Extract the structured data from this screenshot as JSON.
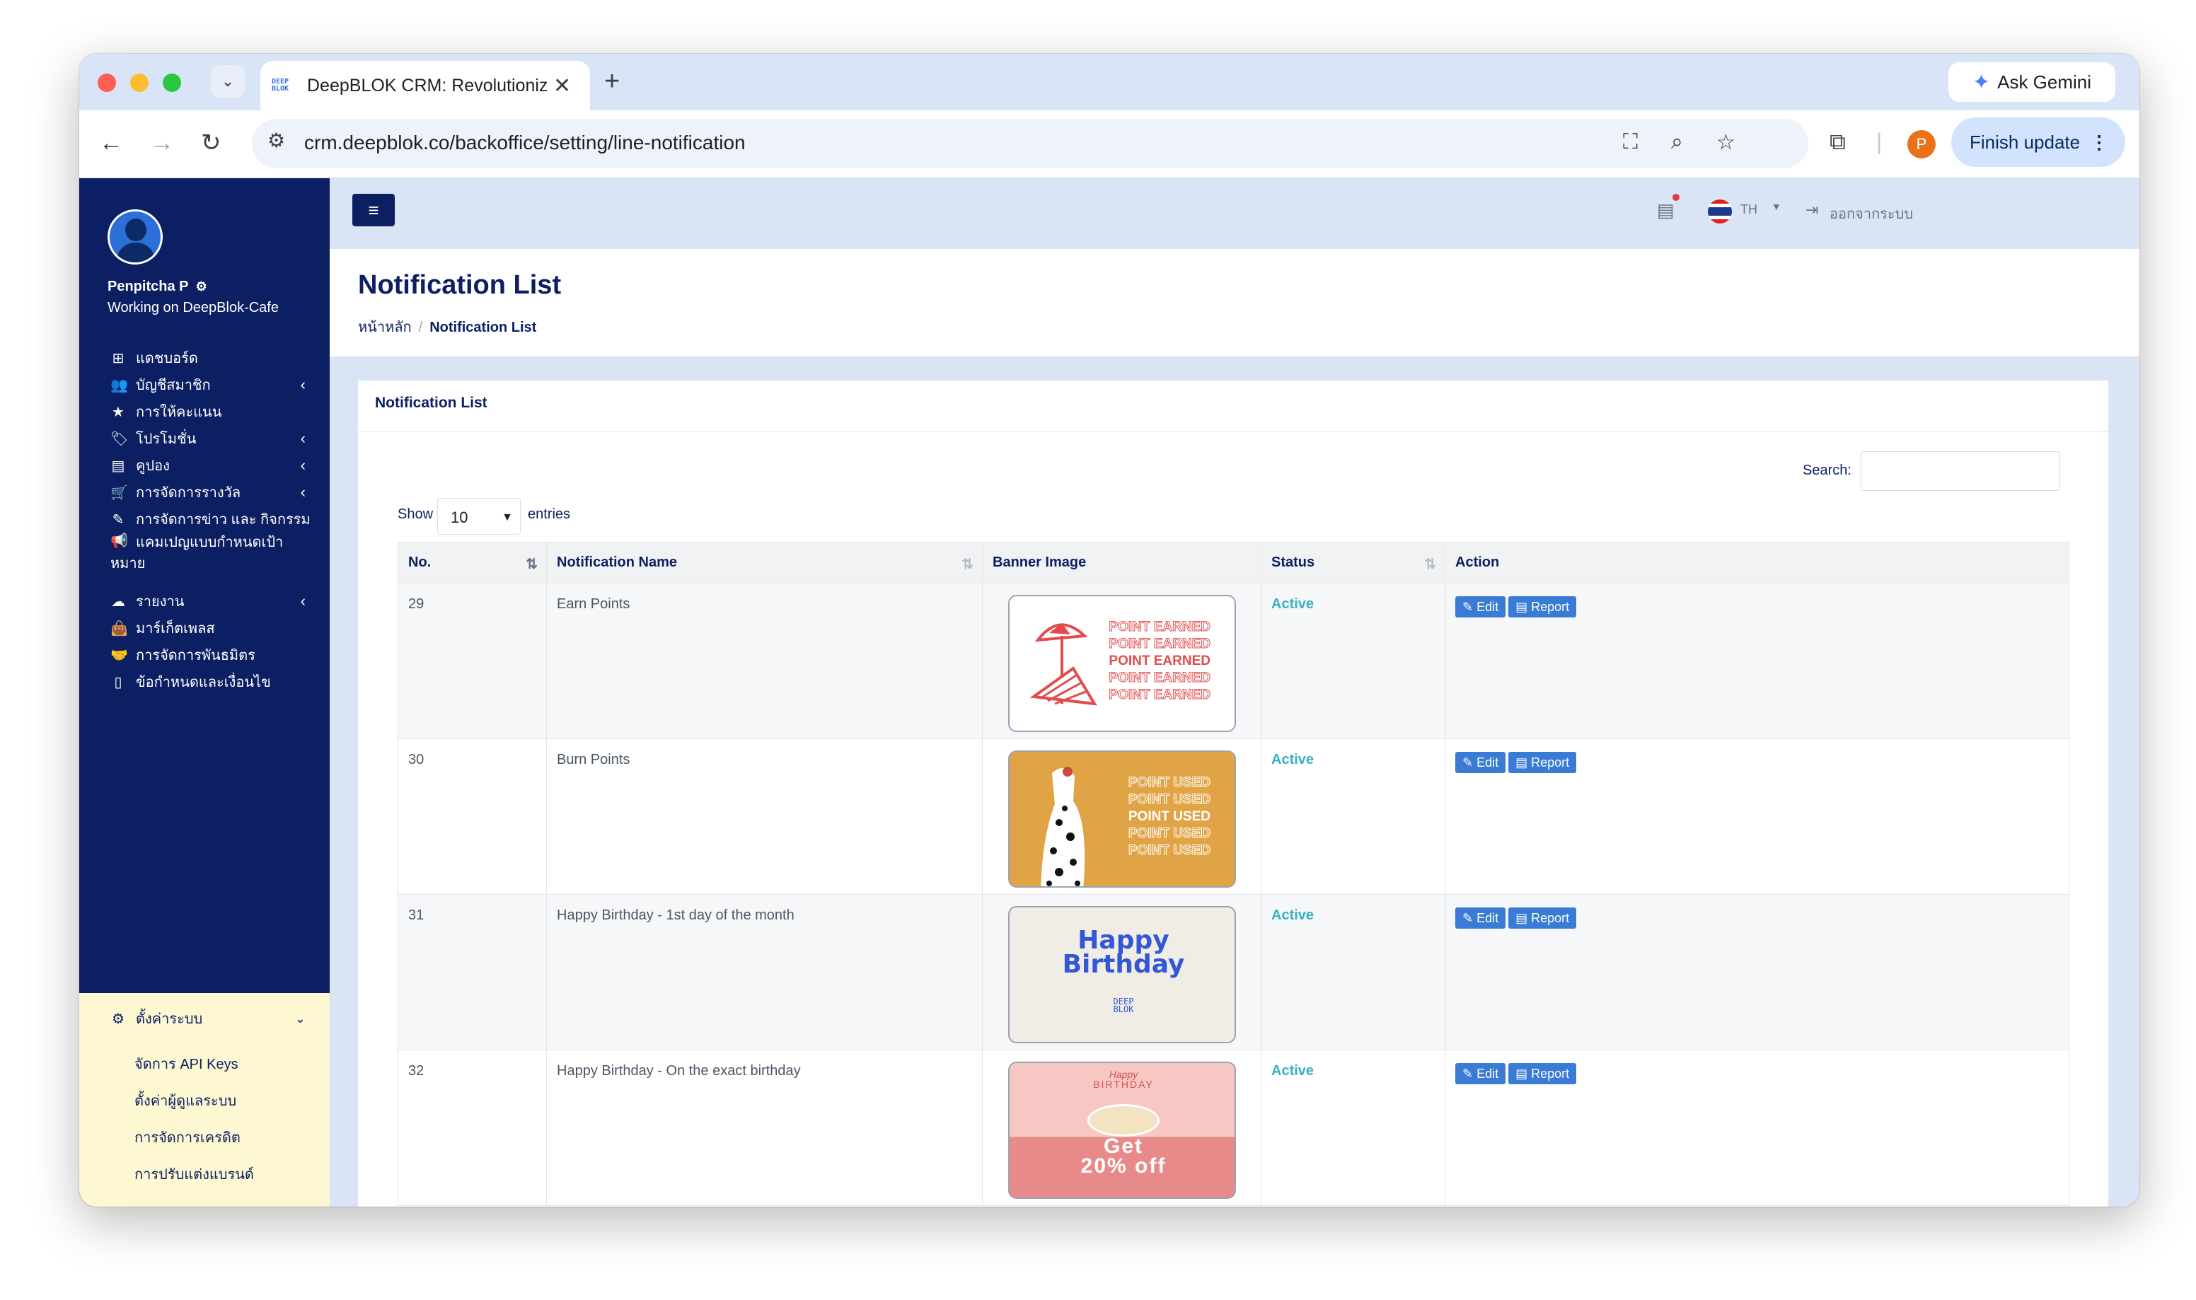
{
  "browser": {
    "tab_title": "DeepBLOK CRM: Revolutioniz",
    "url": "crm.deepblok.co/backoffice/setting/line-notification",
    "gemini_label": "Ask Gemini",
    "finish_label": "Finish update",
    "profile_initial": "P"
  },
  "user": {
    "name": "Penpitcha P",
    "workspace": "Working on DeepBlok-Cafe"
  },
  "sidebar": {
    "items": [
      {
        "label": "แดชบอร์ด",
        "icon": "dashboard-icon"
      },
      {
        "label": "บัญชีสมาชิก",
        "icon": "users-icon"
      },
      {
        "label": "การให้คะแนน",
        "icon": "star-icon"
      },
      {
        "label": "โปรโมชั่น",
        "icon": "tag-icon"
      },
      {
        "label": "คูปอง",
        "icon": "ticket-icon"
      },
      {
        "label": "การจัดการรางวัล",
        "icon": "cart-icon"
      },
      {
        "label": "การจัดการข่าว และ กิจกรรม",
        "icon": "edit-icon"
      },
      {
        "label": "แคมเปญแบบกำหนดเป้า",
        "label2": "หมาย",
        "icon": "megaphone-icon"
      },
      {
        "label": "รายงาน",
        "icon": "cloud-download-icon"
      },
      {
        "label": "มาร์เก็ตเพลส",
        "icon": "bag-icon"
      },
      {
        "label": "การจัดการพันธมิตร",
        "icon": "handshake-icon"
      },
      {
        "label": "ข้อกำหนดและเงื่อนไข",
        "icon": "document-icon"
      },
      {
        "label": "ตั้งค่าระบบ",
        "icon": "gear-icon"
      }
    ],
    "settings_sub": [
      "จัดการ API Keys",
      "ตั้งค่าผู้ดูแลระบบ",
      "การจัดการเครดิต",
      "การปรับแต่งแบรนด์"
    ]
  },
  "topbar": {
    "lang": "TH",
    "logout": "ออกจากระบบ"
  },
  "page": {
    "title": "Notification List",
    "breadcrumb_home": "หน้าหลัก",
    "breadcrumb_current": "Notification List"
  },
  "card": {
    "title": "Notification List",
    "search_label": "Search:",
    "show_label": "Show",
    "page_length": "10",
    "entries_label": "entries"
  },
  "table": {
    "columns": [
      "No.",
      "Notification Name",
      "Banner Image",
      "Status",
      "Action"
    ],
    "edit_label": "Edit",
    "report_label": "Report",
    "rows": [
      {
        "no": "29",
        "name": "Earn Points",
        "status": "Active"
      },
      {
        "no": "30",
        "name": "Burn Points",
        "status": "Active"
      },
      {
        "no": "31",
        "name": "Happy Birthday - 1st day of the month",
        "status": "Active"
      },
      {
        "no": "32",
        "name": "Happy Birthday - On the exact birthday",
        "status": "Active"
      }
    ]
  },
  "banners": {
    "earn": [
      "POINT EARNED",
      "POINT EARNED",
      "POINT EARNED",
      "POINT EARNED",
      "POINT EARNED"
    ],
    "burn": [
      "POINT USED",
      "POINT USED",
      "POINT USED",
      "POINT USED",
      "POINT USED"
    ],
    "bday_line1": "Happy",
    "bday_line2": "Birthday",
    "bday4_script": "Happy",
    "bday4_title": "BIRTHDAY",
    "bday4_offer1": "Get",
    "bday4_offer2": "20% off"
  },
  "colors": {
    "sidebar": "#0b1f62",
    "accent": "#3a7bd5",
    "status_active": "#3ab0c3",
    "content_bg": "#d9e4f4"
  }
}
